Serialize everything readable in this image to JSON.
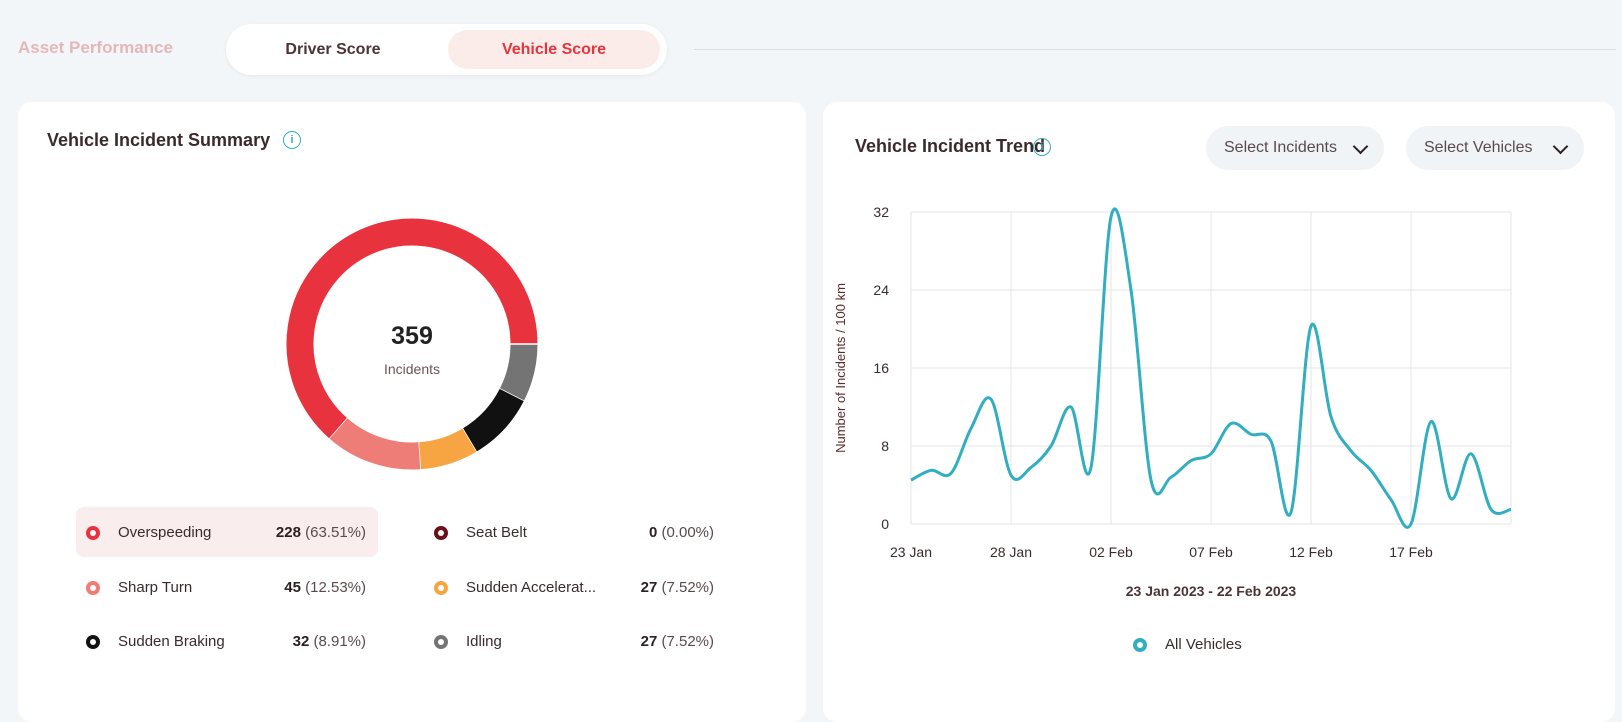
{
  "header": {
    "title": "Asset Performance",
    "tabs": [
      {
        "label": "Driver Score",
        "active": false
      },
      {
        "label": "Vehicle Score",
        "active": true
      }
    ]
  },
  "summary": {
    "title": "Vehicle Incident Summary",
    "total": "359",
    "total_label": "Incidents",
    "items": [
      {
        "label": "Overspeeding",
        "count": "228",
        "pct": "(63.51%)",
        "color": "#e8333f",
        "value": 228
      },
      {
        "label": "Sharp Turn",
        "count": "45",
        "pct": "(12.53%)",
        "color": "#ee7d78",
        "value": 45
      },
      {
        "label": "Sudden Braking",
        "count": "32",
        "pct": "(8.91%)",
        "color": "#111111",
        "value": 32
      },
      {
        "label": "Seat Belt",
        "count": "0",
        "pct": "(0.00%)",
        "color": "#6b0f1a",
        "value": 0
      },
      {
        "label": "Sudden Accelerat...",
        "count": "27",
        "pct": "(7.52%)",
        "color": "#f7a543",
        "value": 27
      },
      {
        "label": "Idling",
        "count": "27",
        "pct": "(7.52%)",
        "color": "#747474",
        "value": 27
      }
    ]
  },
  "trend": {
    "title": "Vehicle Incident Trend",
    "select_incidents": "Select Incidents",
    "select_vehicles": "Select Vehicles",
    "date_range": "23 Jan 2023 - 22 Feb 2023",
    "series_label": "All Vehicles"
  },
  "chart_data": {
    "type": "line",
    "title": "",
    "xlabel": "23 Jan 2023 - 22 Feb 2023",
    "ylabel": "Number of Incidents / 100 km",
    "ylim": [
      0,
      32
    ],
    "yticks": [
      0,
      8,
      16,
      24,
      32
    ],
    "xticks": [
      "23 Jan",
      "28 Jan",
      "02 Feb",
      "07 Feb",
      "12 Feb",
      "17 Feb"
    ],
    "x": [
      "23 Jan",
      "24 Jan",
      "25 Jan",
      "26 Jan",
      "27 Jan",
      "28 Jan",
      "29 Jan",
      "30 Jan",
      "31 Jan",
      "01 Feb",
      "02 Feb",
      "03 Feb",
      "04 Feb",
      "05 Feb",
      "06 Feb",
      "07 Feb",
      "08 Feb",
      "09 Feb",
      "10 Feb",
      "11 Feb",
      "12 Feb",
      "13 Feb",
      "14 Feb",
      "15 Feb",
      "16 Feb",
      "17 Feb",
      "18 Feb",
      "19 Feb",
      "20 Feb",
      "21 Feb",
      "22 Feb"
    ],
    "series": [
      {
        "name": "All Vehicles",
        "color": "#31aec0",
        "values": [
          4.5,
          5.5,
          5.2,
          9.8,
          12.8,
          5.0,
          5.8,
          8.0,
          12.0,
          5.8,
          31.5,
          24.0,
          4.5,
          4.8,
          6.5,
          7.2,
          10.3,
          9.2,
          8.5,
          1.2,
          20.3,
          11.0,
          7.5,
          5.5,
          2.5,
          0.0,
          10.5,
          2.6,
          7.2,
          1.5,
          1.5
        ]
      }
    ],
    "grid": true,
    "legend": "bottom"
  }
}
